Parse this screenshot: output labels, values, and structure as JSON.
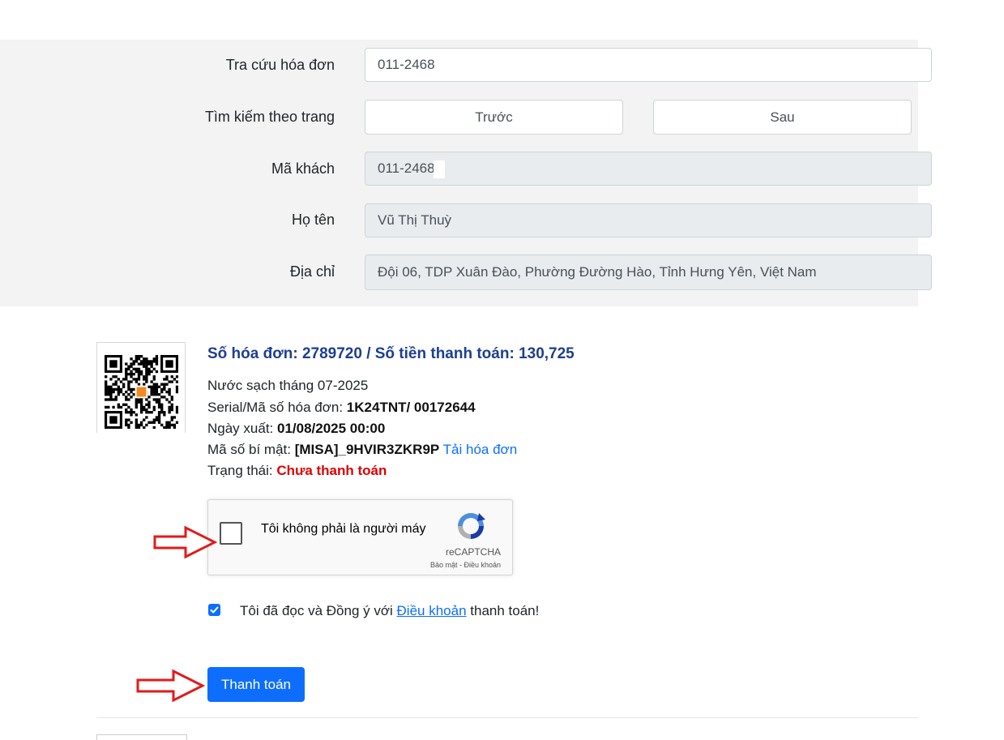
{
  "search": {
    "lookup_label": "Tra cứu hóa đơn",
    "lookup_value": "011-2468",
    "paging_label": "Tìm kiếm theo trang",
    "prev_label": "Trước",
    "next_label": "Sau"
  },
  "customer": {
    "code_label": "Mã khách",
    "code_value": "011-2468",
    "name_label": "Họ tên",
    "name_value": "Vũ Thị Thuỳ",
    "address_label": "Địa chỉ",
    "address_value": "Đội 06, TDP Xuân Đào, Phường Đường Hào, Tỉnh Hưng Yên, Việt Nam"
  },
  "invoice": {
    "title": "Số hóa đơn: 2789720 / Số tiền thanh toán: 130,725",
    "description": "Nước sạch tháng 07-2025",
    "serial_label": "Serial/Mã số hóa đơn: ",
    "serial_value": "1K24TNT/ 00172644",
    "date_label": "Ngày xuất: ",
    "date_value": "01/08/2025 00:00",
    "secret_label": "Mã số bí mật: ",
    "secret_value": "[MISA]_9HVIR3ZKR9P",
    "download_link": "Tải hóa đơn",
    "status_label": "Trạng thái: ",
    "status_value": "Chưa thanh toán",
    "status_color": "#e00000"
  },
  "captcha": {
    "text": "Tôi không phải là người máy",
    "brand": "reCAPTCHA",
    "terms": "Bảo mật - Điều khoản"
  },
  "agreement": {
    "checked": true,
    "prefix": "Tôi đã đọc và Đồng ý với ",
    "link": "Điều khoản",
    "suffix": " thanh toán!"
  },
  "actions": {
    "pay_label": "Thanh toán"
  },
  "colors": {
    "primary": "#0d6efd",
    "title_blue": "#1e3f8f",
    "annotation_arrow": "#e01b1b"
  },
  "icons": {
    "qr": "qr-code-icon",
    "captcha_logo": "recaptcha-logo-icon",
    "check": "check-icon",
    "arrow": "red-arrow-icon"
  }
}
